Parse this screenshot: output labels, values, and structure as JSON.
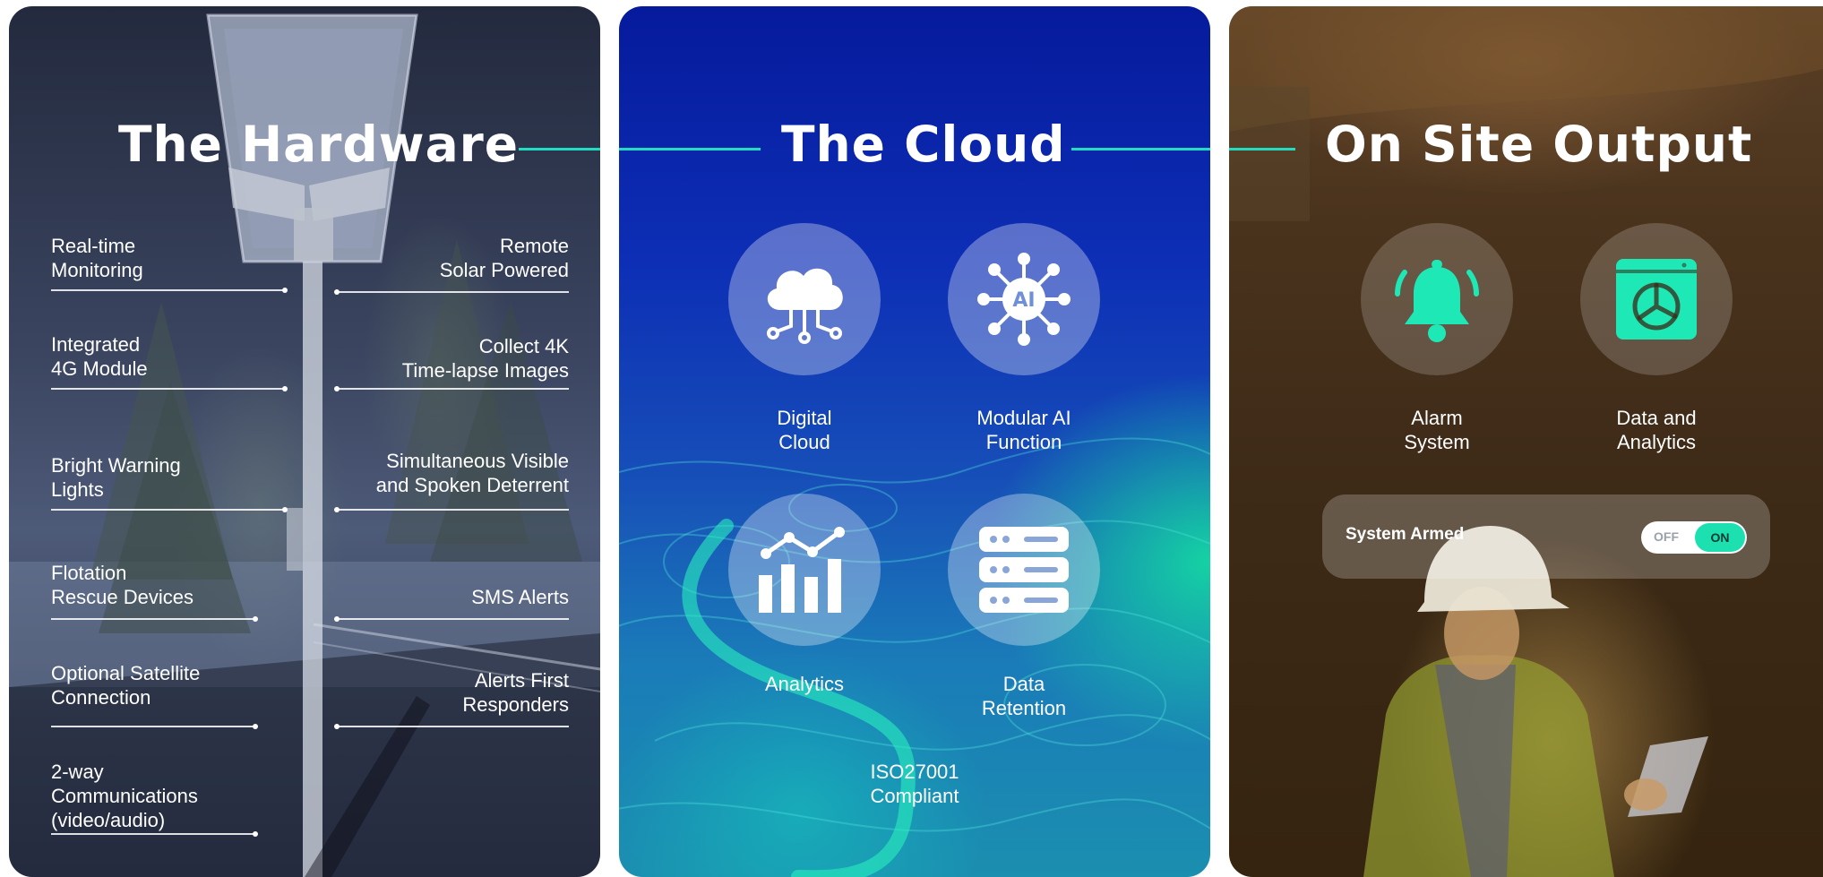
{
  "colors": {
    "accent": "#21dcc0",
    "icon_accent": "#1ee8b5",
    "toggle_on": "#1ce0b0",
    "text": "#ffffff"
  },
  "hardware": {
    "title": "The Hardware",
    "features_left": [
      {
        "lines": [
          "Real-time",
          "Monitoring"
        ]
      },
      {
        "lines": [
          "Integrated",
          "4G Module"
        ]
      },
      {
        "lines": [
          "Bright Warning",
          "Lights"
        ]
      },
      {
        "lines": [
          "Flotation",
          "Rescue Devices"
        ]
      },
      {
        "lines": [
          "Optional Satellite",
          "Connection"
        ]
      },
      {
        "lines": [
          "2-way",
          "Communications",
          "(video/audio)"
        ]
      }
    ],
    "features_right": [
      {
        "lines": [
          "Remote",
          "Solar Powered"
        ]
      },
      {
        "lines": [
          "Collect 4K",
          "Time-lapse Images"
        ]
      },
      {
        "lines": [
          "Simultaneous Visible",
          "and Spoken Deterrent"
        ]
      },
      {
        "lines": [
          "SMS Alerts"
        ]
      },
      {
        "lines": [
          "Alerts First",
          "Responders"
        ]
      }
    ]
  },
  "cloud": {
    "title": "The Cloud",
    "items": [
      {
        "icon": "cloud-network-icon",
        "lines": [
          "Digital",
          "Cloud"
        ]
      },
      {
        "icon": "ai-chip-icon",
        "icon_text": "AI",
        "lines": [
          "Modular AI",
          "Function"
        ]
      },
      {
        "icon": "analytics-chart-icon",
        "lines": [
          "Analytics"
        ]
      },
      {
        "icon": "server-storage-icon",
        "lines": [
          "Data",
          "Retention"
        ]
      }
    ],
    "compliance": [
      "ISO27001",
      "Compliant"
    ]
  },
  "onsite": {
    "title": "On Site Output",
    "items": [
      {
        "icon": "alarm-bell-icon",
        "lines": [
          "Alarm",
          "System"
        ]
      },
      {
        "icon": "dashboard-pie-icon",
        "lines": [
          "Data and",
          "Analytics"
        ]
      }
    ],
    "armed": {
      "label": "System Armed",
      "off_label": "OFF",
      "on_label": "ON",
      "state": "ON"
    }
  }
}
